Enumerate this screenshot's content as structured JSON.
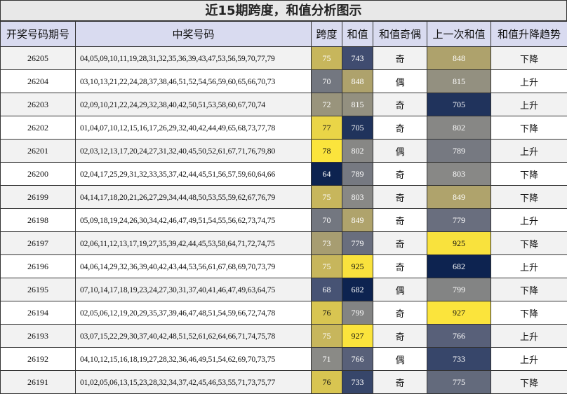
{
  "title": "近15期跨度，和值分析图示",
  "headers": [
    "开奖号码期号",
    "中奖号码",
    "跨度",
    "和值",
    "和值奇偶",
    "上一次和值",
    "和值升降趋势"
  ],
  "rows": [
    {
      "issue": "26205",
      "numbers": "04,05,09,10,11,19,28,31,32,35,36,39,43,47,53,56,59,70,77,79",
      "span": "75",
      "sum": "743",
      "parity": "奇",
      "prev_sum": "848",
      "trend": "下降"
    },
    {
      "issue": "26204",
      "numbers": "03,10,13,21,22,24,28,37,38,46,51,52,54,56,59,60,65,66,70,73",
      "span": "70",
      "sum": "848",
      "parity": "偶",
      "prev_sum": "815",
      "trend": "上升"
    },
    {
      "issue": "26203",
      "numbers": "02,09,10,21,22,24,29,32,38,40,42,50,51,53,58,60,67,70,74",
      "span": "72",
      "sum": "815",
      "parity": "奇",
      "prev_sum": "705",
      "trend": "上升"
    },
    {
      "issue": "26202",
      "numbers": "01,04,07,10,12,15,16,17,26,29,32,40,42,44,49,65,68,73,77,78",
      "span": "77",
      "sum": "705",
      "parity": "奇",
      "prev_sum": "802",
      "trend": "下降"
    },
    {
      "issue": "26201",
      "numbers": "02,03,12,13,17,20,24,27,31,32,40,45,50,52,61,67,71,76,79,80",
      "span": "78",
      "sum": "802",
      "parity": "偶",
      "prev_sum": "789",
      "trend": "上升"
    },
    {
      "issue": "26200",
      "numbers": "02,04,17,25,29,31,32,33,35,37,42,44,45,51,56,57,59,60,64,66",
      "span": "64",
      "sum": "789",
      "parity": "奇",
      "prev_sum": "803",
      "trend": "下降"
    },
    {
      "issue": "26199",
      "numbers": "04,14,17,18,20,21,26,27,29,34,44,48,50,53,55,59,62,67,76,79",
      "span": "75",
      "sum": "803",
      "parity": "奇",
      "prev_sum": "849",
      "trend": "下降"
    },
    {
      "issue": "26198",
      "numbers": "05,09,18,19,24,26,30,34,42,46,47,49,51,54,55,56,62,73,74,75",
      "span": "70",
      "sum": "849",
      "parity": "奇",
      "prev_sum": "779",
      "trend": "上升"
    },
    {
      "issue": "26197",
      "numbers": "02,06,11,12,13,17,19,27,35,39,42,44,45,53,58,64,71,72,74,75",
      "span": "73",
      "sum": "779",
      "parity": "奇",
      "prev_sum": "925",
      "trend": "下降"
    },
    {
      "issue": "26196",
      "numbers": "04,06,14,29,32,36,39,40,42,43,44,53,56,61,67,68,69,70,73,79",
      "span": "75",
      "sum": "925",
      "parity": "奇",
      "prev_sum": "682",
      "trend": "上升"
    },
    {
      "issue": "26195",
      "numbers": "07,10,14,17,18,19,23,24,27,30,31,37,40,41,46,47,49,63,64,75",
      "span": "68",
      "sum": "682",
      "parity": "偶",
      "prev_sum": "799",
      "trend": "下降"
    },
    {
      "issue": "26194",
      "numbers": "02,05,06,12,19,20,29,35,37,39,46,47,48,51,54,59,66,72,74,78",
      "span": "76",
      "sum": "799",
      "parity": "奇",
      "prev_sum": "927",
      "trend": "下降"
    },
    {
      "issue": "26193",
      "numbers": "03,07,15,22,29,30,37,40,42,48,51,52,61,62,64,66,71,74,75,78",
      "span": "75",
      "sum": "927",
      "parity": "奇",
      "prev_sum": "766",
      "trend": "上升"
    },
    {
      "issue": "26192",
      "numbers": "04,10,12,15,16,18,19,27,28,32,36,46,49,51,54,62,69,70,73,75",
      "span": "71",
      "sum": "766",
      "parity": "偶",
      "prev_sum": "733",
      "trend": "上升"
    },
    {
      "issue": "26191",
      "numbers": "01,02,05,06,13,15,23,28,32,34,37,42,45,46,53,55,71,73,75,77",
      "span": "76",
      "sum": "733",
      "parity": "奇",
      "prev_sum": "775",
      "trend": "下降"
    }
  ],
  "colors": {
    "span_low": "#0d2350",
    "span_high": "#fbe43c",
    "sum_low": "#0d2350",
    "sum_high": "#fbe43c",
    "header_bg": "#d9dbf0",
    "title_bg": "#e8e8e8"
  }
}
